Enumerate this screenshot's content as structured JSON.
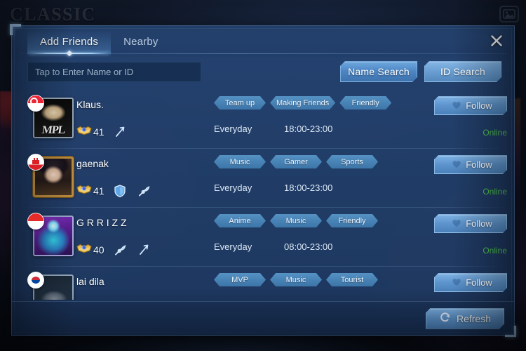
{
  "background": {
    "mode_title": "CLASSIC",
    "top_right_icon": "image-icon"
  },
  "dialog": {
    "tabs": [
      {
        "label": "Add Friends",
        "active": true
      },
      {
        "label": "Nearby",
        "active": false
      }
    ],
    "close_icon": "close-icon",
    "search": {
      "placeholder": "Tap to Enter Name or ID",
      "value": "",
      "name_search_label": "Name Search",
      "id_search_label": "ID Search"
    },
    "footer": {
      "refresh_label": "Refresh",
      "refresh_icon": "refresh-icon"
    },
    "colors": {
      "accent": "#5f96cf",
      "online": "#4fc24f",
      "tag": "#4e88bf",
      "panel": "#24426f"
    },
    "friends": [
      {
        "name": "Klaus.",
        "flag": "singapore",
        "avatar": "mpl-klaus",
        "level": "41",
        "roles": [
          "marksman-icon"
        ],
        "tags": [
          "Team up",
          "Making Friends",
          "Friendly"
        ],
        "day": "Everyday",
        "time": "18:00-23:00",
        "follow_label": "Follow",
        "status": "Online"
      },
      {
        "name": "gaenak",
        "flag": "gibraltar",
        "avatar": "anime-gaenak",
        "level": "41",
        "roles": [
          "tank-icon",
          "support-icon"
        ],
        "tags": [
          "Music",
          "Gamer",
          "Sports"
        ],
        "day": "Everyday",
        "time": "18:00-23:00",
        "follow_label": "Follow",
        "status": "Online"
      },
      {
        "name": "G R R I Z Z",
        "flag": "indonesia",
        "avatar": "neon-grrizz",
        "level": "40",
        "roles": [
          "support-icon",
          "marksman-icon"
        ],
        "tags": [
          "Anime",
          "Music",
          "Friendly"
        ],
        "day": "Everyday",
        "time": "08:00-23:00",
        "follow_label": "Follow",
        "status": "Online"
      },
      {
        "name": "lai  dila",
        "flag": "southkorea",
        "avatar": "sleep-lai",
        "level": "",
        "roles": [],
        "tags": [
          "MVP",
          "Music",
          "Tourist"
        ],
        "day": "",
        "time": "",
        "follow_label": "Follow",
        "status": ""
      }
    ]
  }
}
